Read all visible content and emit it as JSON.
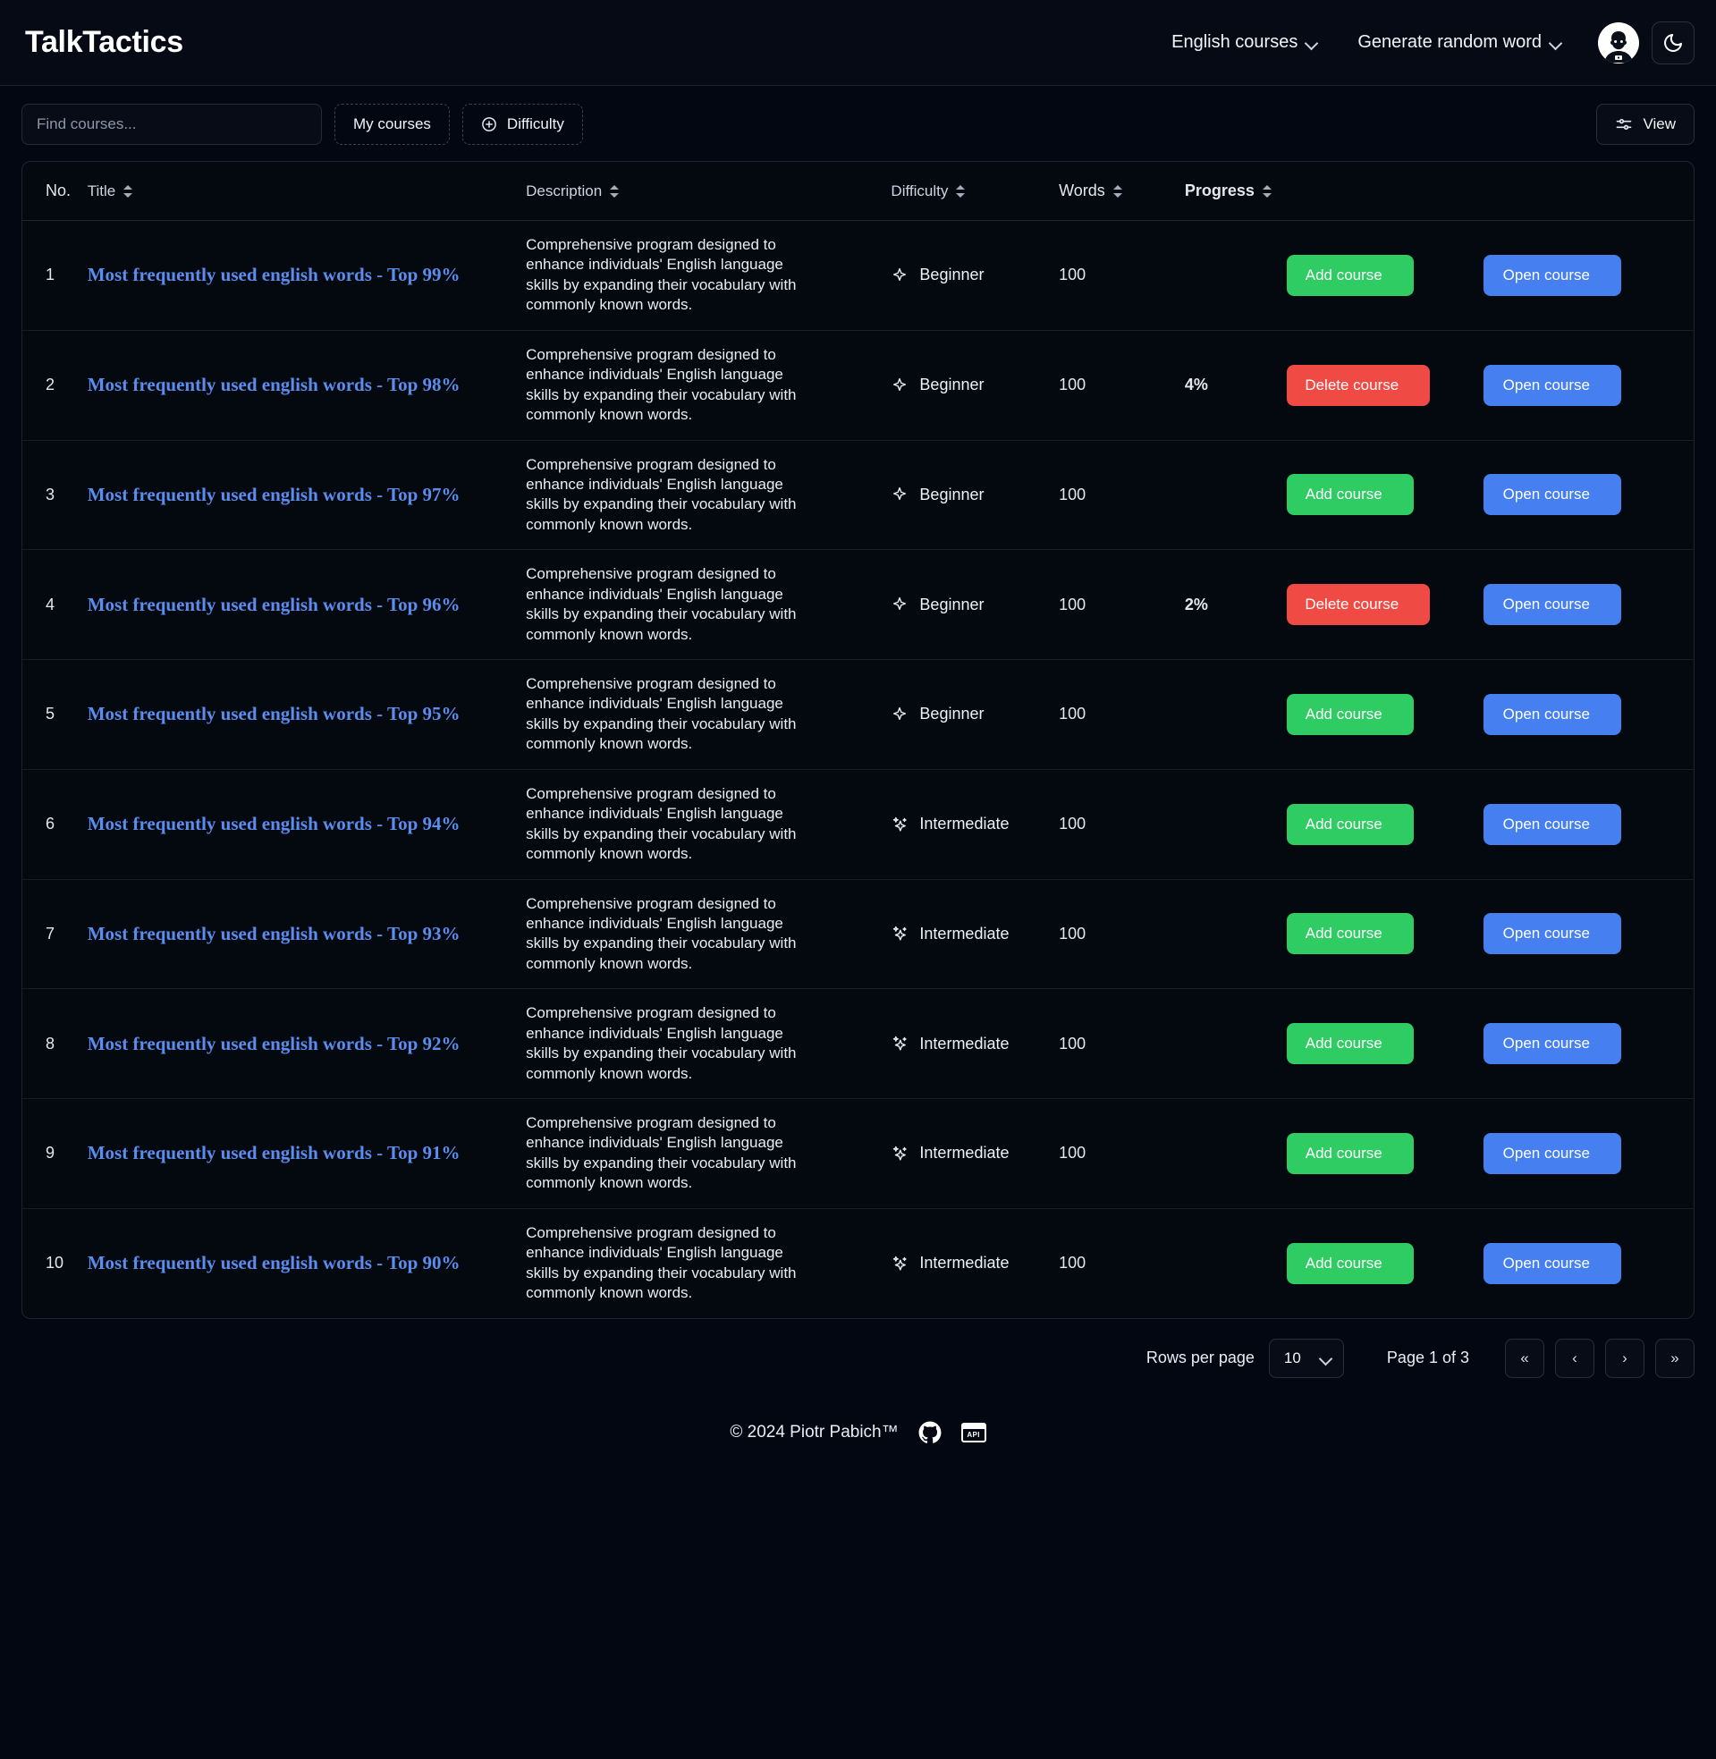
{
  "header": {
    "brand": "TalkTactics",
    "nav": [
      {
        "label": "English courses",
        "icon": "chevron-down-icon"
      },
      {
        "label": "Generate random word",
        "icon": "chevron-down-icon"
      }
    ],
    "avatar_icon": "user-avatar",
    "theme_toggle_icon": "moon-icon"
  },
  "toolbar": {
    "search_placeholder": "Find courses...",
    "search_value": "",
    "my_courses_label": "My courses",
    "difficulty_label": "Difficulty",
    "difficulty_icon": "plus-circle-icon",
    "view_label": "View",
    "view_icon": "sliders-icon"
  },
  "table": {
    "columns": [
      {
        "key": "no",
        "label": "No.",
        "sortable": false
      },
      {
        "key": "title",
        "label": "Title",
        "sortable": true
      },
      {
        "key": "description",
        "label": "Description",
        "sortable": true
      },
      {
        "key": "difficulty",
        "label": "Difficulty",
        "sortable": true
      },
      {
        "key": "words",
        "label": "Words",
        "sortable": true
      },
      {
        "key": "progress",
        "label": "Progress",
        "sortable": true
      }
    ],
    "description_text": "Comprehensive program designed to enhance individuals' English language skills by expanding their vocabulary with commonly known words.",
    "open_label": "Open course",
    "open_icon": "book-open-icon",
    "add_label": "Add course",
    "add_icon": "plus-icon",
    "delete_label": "Delete course",
    "delete_icon": "trash-icon",
    "rows": [
      {
        "no": "1",
        "title": "Most frequently used english words - Top 99%",
        "difficulty": "Beginner",
        "words": "100",
        "progress": "",
        "action": "add"
      },
      {
        "no": "2",
        "title": "Most frequently used english words - Top 98%",
        "difficulty": "Beginner",
        "words": "100",
        "progress": "4%",
        "action": "delete"
      },
      {
        "no": "3",
        "title": "Most frequently used english words - Top 97%",
        "difficulty": "Beginner",
        "words": "100",
        "progress": "",
        "action": "add"
      },
      {
        "no": "4",
        "title": "Most frequently used english words - Top 96%",
        "difficulty": "Beginner",
        "words": "100",
        "progress": "2%",
        "action": "delete"
      },
      {
        "no": "5",
        "title": "Most frequently used english words - Top 95%",
        "difficulty": "Beginner",
        "words": "100",
        "progress": "",
        "action": "add"
      },
      {
        "no": "6",
        "title": "Most frequently used english words - Top 94%",
        "difficulty": "Intermediate",
        "words": "100",
        "progress": "",
        "action": "add"
      },
      {
        "no": "7",
        "title": "Most frequently used english words - Top 93%",
        "difficulty": "Intermediate",
        "words": "100",
        "progress": "",
        "action": "add"
      },
      {
        "no": "8",
        "title": "Most frequently used english words - Top 92%",
        "difficulty": "Intermediate",
        "words": "100",
        "progress": "",
        "action": "add"
      },
      {
        "no": "9",
        "title": "Most frequently used english words - Top 91%",
        "difficulty": "Intermediate",
        "words": "100",
        "progress": "",
        "action": "add"
      },
      {
        "no": "10",
        "title": "Most frequently used english words - Top 90%",
        "difficulty": "Intermediate",
        "words": "100",
        "progress": "",
        "action": "add"
      }
    ]
  },
  "pagination": {
    "rows_per_page_label": "Rows per page",
    "rows_per_page_value": "10",
    "page_label": "Page 1 of 3",
    "first_label": "«",
    "prev_label": "‹",
    "next_label": "›",
    "last_label": "»"
  },
  "footer": {
    "copyright": "© 2024 Piotr Pabich™",
    "github_icon": "github-icon",
    "api_icon": "api-icon",
    "api_text": "API"
  },
  "colors": {
    "background": "#030712",
    "accent_blue": "#4680f0",
    "title_link": "#5b8dee",
    "success_green": "#2ecc63",
    "danger_red": "#f04a44",
    "border": "#1d2533"
  }
}
